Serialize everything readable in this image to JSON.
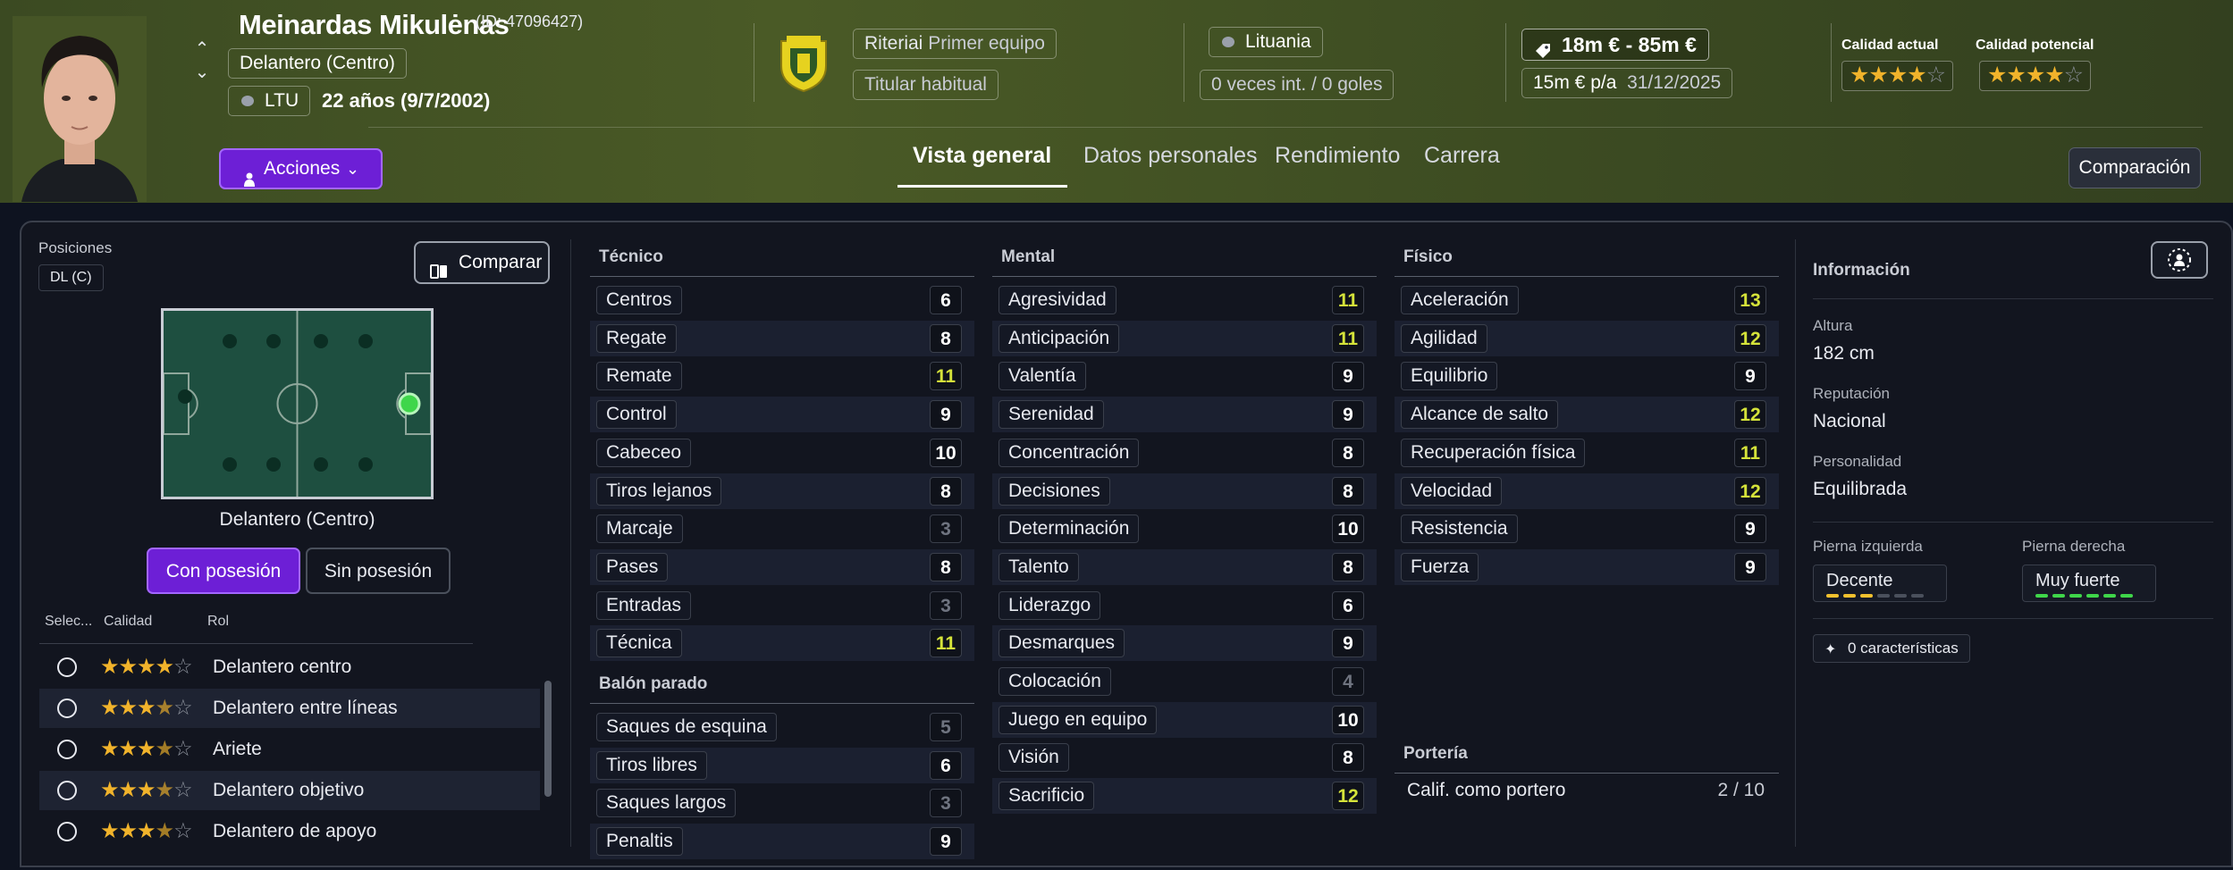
{
  "header": {
    "player_name": "Meinardas Mikulėnas",
    "player_id": "(ID: 47096427)",
    "position": "Delantero (Centro)",
    "nation_code": "LTU",
    "age_dob": "22 años (9/7/2002)",
    "actions_label": "Acciones",
    "club": {
      "label": "Riteriai",
      "value": "Primer equipo"
    },
    "squad_status": "Titular habitual",
    "nationality": "Lituania",
    "caps": "0 veces int. / 0 goles",
    "value_range": "18m € - 85m €",
    "wage": "15m € p/a",
    "contract_end": "31/12/2025",
    "current_ability_label": "Calidad actual",
    "potential_ability_label": "Calidad potencial",
    "current_ability_stars": 3.5,
    "potential_ability_stars": 4,
    "tabs": [
      "Vista general",
      "Datos personales",
      "Rendimiento",
      "Carrera"
    ],
    "active_tab": "Vista general",
    "compare_label": "Comparación"
  },
  "left": {
    "positions_label": "Posiciones",
    "position_chip": "DL (C)",
    "compare_button": "Comparar",
    "pitch_caption": "Delantero (Centro)",
    "toggle_on": "Con posesión",
    "toggle_off": "Sin posesión",
    "roles_header": {
      "select": "Selec...",
      "quality": "Calidad",
      "role": "Rol"
    },
    "roles": [
      {
        "name": "Delantero centro",
        "stars": 4
      },
      {
        "name": "Delantero entre líneas",
        "stars": 3.5
      },
      {
        "name": "Ariete",
        "stars": 3.5
      },
      {
        "name": "Delantero objetivo",
        "stars": 3.5
      },
      {
        "name": "Delantero de apoyo",
        "stars": 3.5
      }
    ]
  },
  "technical": {
    "title": "Técnico",
    "attrs": [
      {
        "name": "Centros",
        "value": "6",
        "tone": "white"
      },
      {
        "name": "Regate",
        "value": "8",
        "tone": "white"
      },
      {
        "name": "Remate",
        "value": "11",
        "tone": "yellow"
      },
      {
        "name": "Control",
        "value": "9",
        "tone": "white"
      },
      {
        "name": "Cabeceo",
        "value": "10",
        "tone": "white"
      },
      {
        "name": "Tiros lejanos",
        "value": "8",
        "tone": "white"
      },
      {
        "name": "Marcaje",
        "value": "3",
        "tone": "grey"
      },
      {
        "name": "Pases",
        "value": "8",
        "tone": "white"
      },
      {
        "name": "Entradas",
        "value": "3",
        "tone": "grey"
      },
      {
        "name": "Técnica",
        "value": "11",
        "tone": "yellow"
      }
    ]
  },
  "set_pieces": {
    "title": "Balón parado",
    "attrs": [
      {
        "name": "Saques de esquina",
        "value": "5",
        "tone": "grey"
      },
      {
        "name": "Tiros libres",
        "value": "6",
        "tone": "white"
      },
      {
        "name": "Saques largos",
        "value": "3",
        "tone": "grey"
      },
      {
        "name": "Penaltis",
        "value": "9",
        "tone": "white"
      }
    ]
  },
  "mental": {
    "title": "Mental",
    "attrs": [
      {
        "name": "Agresividad",
        "value": "11",
        "tone": "yellow"
      },
      {
        "name": "Anticipación",
        "value": "11",
        "tone": "yellow"
      },
      {
        "name": "Valentía",
        "value": "9",
        "tone": "white"
      },
      {
        "name": "Serenidad",
        "value": "9",
        "tone": "white"
      },
      {
        "name": "Concentración",
        "value": "8",
        "tone": "white"
      },
      {
        "name": "Decisiones",
        "value": "8",
        "tone": "white"
      },
      {
        "name": "Determinación",
        "value": "10",
        "tone": "white"
      },
      {
        "name": "Talento",
        "value": "8",
        "tone": "white"
      },
      {
        "name": "Liderazgo",
        "value": "6",
        "tone": "white"
      },
      {
        "name": "Desmarques",
        "value": "9",
        "tone": "white"
      },
      {
        "name": "Colocación",
        "value": "4",
        "tone": "grey"
      },
      {
        "name": "Juego en equipo",
        "value": "10",
        "tone": "white"
      },
      {
        "name": "Visión",
        "value": "8",
        "tone": "white"
      },
      {
        "name": "Sacrificio",
        "value": "12",
        "tone": "yellow"
      }
    ]
  },
  "physical": {
    "title": "Físico",
    "attrs": [
      {
        "name": "Aceleración",
        "value": "13",
        "tone": "yellow"
      },
      {
        "name": "Agilidad",
        "value": "12",
        "tone": "yellow"
      },
      {
        "name": "Equilibrio",
        "value": "9",
        "tone": "white"
      },
      {
        "name": "Alcance de salto",
        "value": "12",
        "tone": "yellow"
      },
      {
        "name": "Recuperación física",
        "value": "11",
        "tone": "yellow"
      },
      {
        "name": "Velocidad",
        "value": "12",
        "tone": "yellow"
      },
      {
        "name": "Resistencia",
        "value": "9",
        "tone": "white"
      },
      {
        "name": "Fuerza",
        "value": "9",
        "tone": "white"
      }
    ]
  },
  "goalkeeping": {
    "title": "Portería",
    "label": "Calif. como portero",
    "value": "2 / 10"
  },
  "info": {
    "title": "Información",
    "height_label": "Altura",
    "height": "182 cm",
    "reputation_label": "Reputación",
    "reputation": "Nacional",
    "personality_label": "Personalidad",
    "personality": "Equilibrada",
    "left_foot_label": "Pierna izquierda",
    "left_foot": "Decente",
    "left_foot_level": 3,
    "right_foot_label": "Pierna derecha",
    "right_foot": "Muy fuerte",
    "right_foot_level": 6,
    "traits_label": "0 características"
  },
  "colors": {
    "accent_purple": "#6d1fd6",
    "value_yellow": "#d5e33a",
    "star_gold": "#f1b32b",
    "foot_left": "#f2c12e",
    "foot_right": "#3fd64a"
  }
}
